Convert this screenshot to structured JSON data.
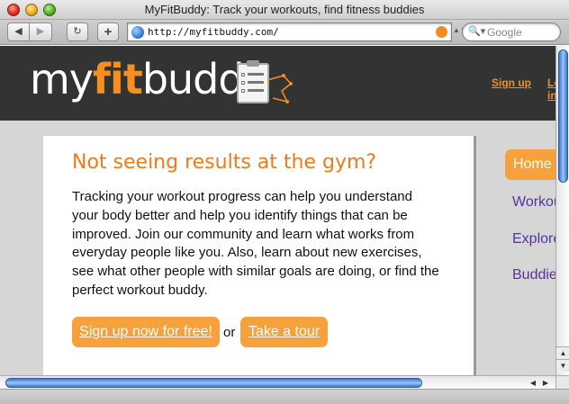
{
  "window": {
    "title": "MyFitBuddy: Track your workouts, find fitness buddies"
  },
  "toolbar": {
    "back_glyph": "◀",
    "forward_glyph": "▶",
    "reload_glyph": "↻",
    "add_glyph": "+",
    "url": "http://myfitbuddy.com/",
    "search_placeholder": "Google",
    "search_glyph": "🔍▾"
  },
  "header": {
    "logo": {
      "part1": "my",
      "part2": "fit",
      "part3": "buddy"
    },
    "links": {
      "signup": "Sign up",
      "login": "Log in"
    }
  },
  "main": {
    "headline": "Not seeing results at the gym?",
    "body": "Tracking your workout progress can help you understand your body better and help you identify things that can be improved. Join our community and learn what works from everyday people like you. Also, learn about new exercises, see what other people with similar goals are doing, or find the perfect workout buddy.",
    "cta_signup": "Sign up now for free!",
    "or": "or",
    "cta_tour": "Take a tour"
  },
  "sidebar": {
    "items": [
      {
        "label": "Home",
        "active": true
      },
      {
        "label": "Workouts",
        "active": false
      },
      {
        "label": "Explore",
        "active": false
      },
      {
        "label": "Buddies",
        "active": false
      }
    ]
  },
  "scrollbars": {
    "up": "▲",
    "down": "▼",
    "left": "◀",
    "right": "▶"
  },
  "colors": {
    "accent": "#f7a13c",
    "brand_orange": "#f78f1e",
    "nav_purple": "#55339a",
    "header_bg": "#333333"
  }
}
